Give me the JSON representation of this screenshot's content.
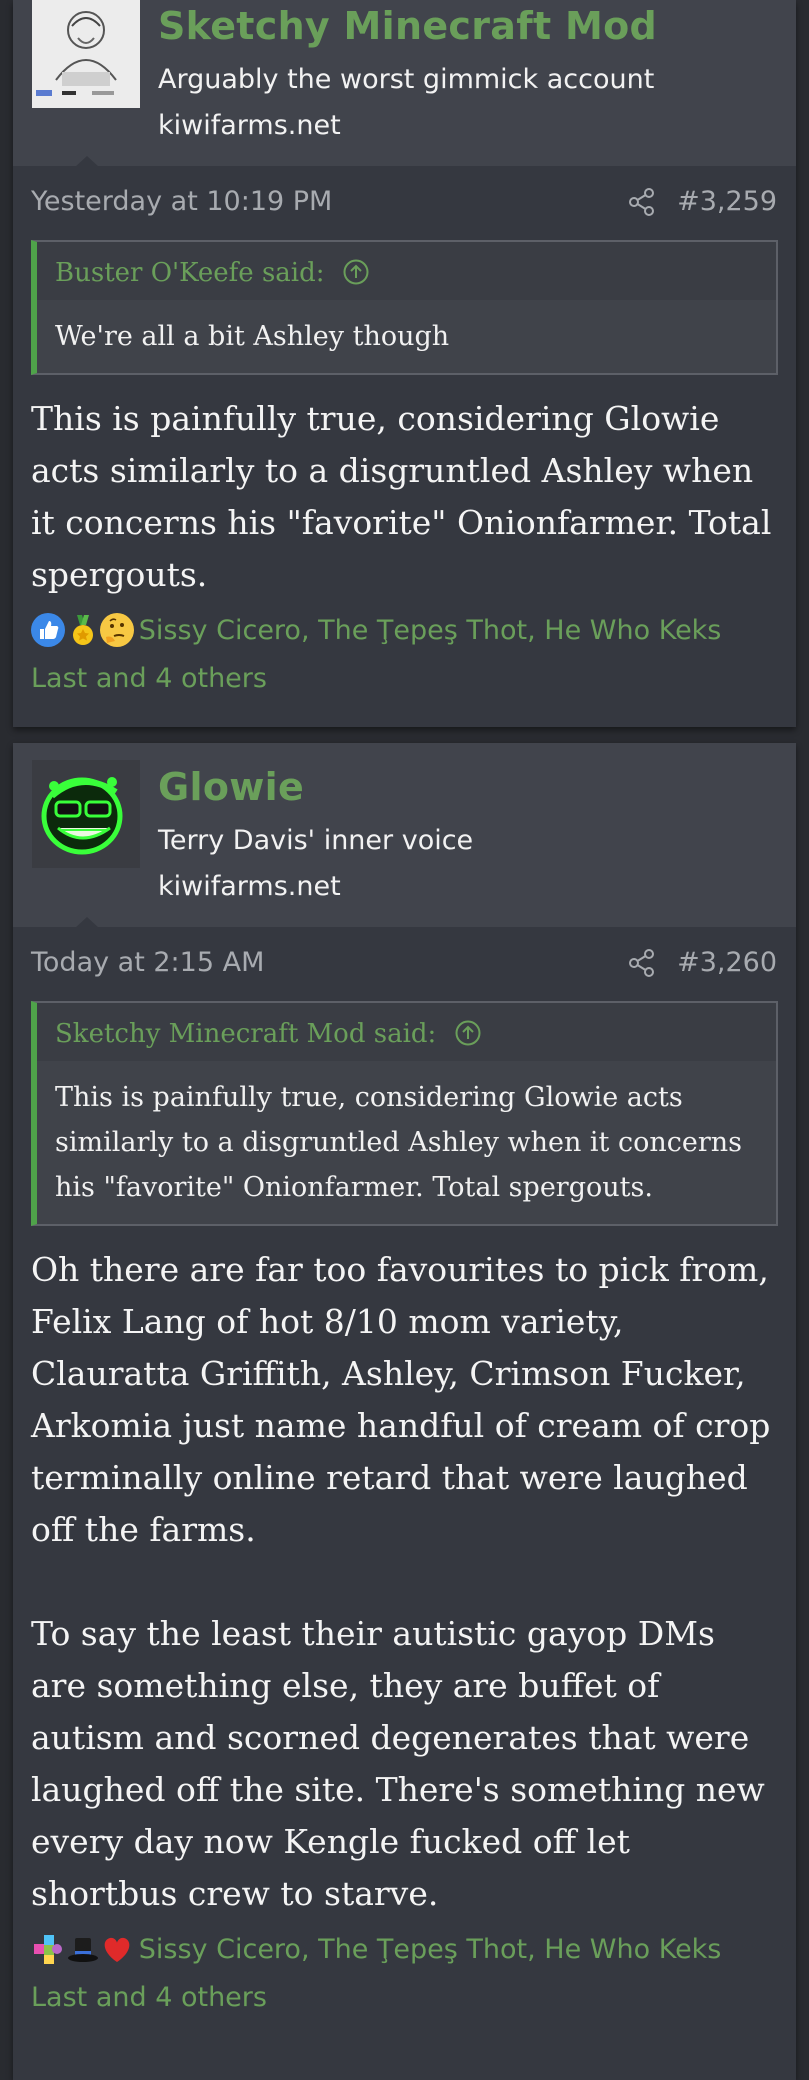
{
  "posts": [
    {
      "author": "Sketchy Minecraft Mod",
      "title": "Arguably the worst gimmick account",
      "site": "kiwifarms.net",
      "date": "Yesterday at 10:19 PM",
      "number": "#3,259",
      "quote": {
        "header": "Buster O'Keefe said:",
        "body": "We're all a bit Ashley though"
      },
      "message": [
        "This is painfully true, considering Glowie acts similarly to a disgruntled Ashley when it concerns his \"favorite\" Onionfarmer. Total spergouts."
      ],
      "reactions": {
        "icons": [
          "thumbs-up",
          "medal",
          "thinking-face"
        ],
        "text": "Sissy Cicero, The Ţepeş Thot, He Who Keks Last and 4 others"
      }
    },
    {
      "author": "Glowie",
      "title": "Terry Davis' inner voice",
      "site": "kiwifarms.net",
      "date": "Today at 2:15 AM",
      "number": "#3,260",
      "quote": {
        "header": "Sketchy Minecraft Mod said:",
        "body": "This is painfully true, considering Glowie acts similarly to a disgruntled Ashley when it concerns his \"favorite\" Onionfarmer. Total spergouts."
      },
      "message": [
        "Oh there are far too favourites to pick from, Felix Lang of hot 8/10 mom variety, Clauratta Griffith, Ashley, Crimson Fucker, Arkomia just name handful of cream of crop terminally online retard that were laughed off the farms.",
        "To say the least their autistic gayop DMs are something else, they are buffet of autism and scorned degenerates that were laughed off the site. There's something new every day now Kengle fucked off let shortbus crew to starve."
      ],
      "reactions": {
        "icons": [
          "puzzle-piece",
          "top-hat",
          "heart"
        ],
        "text": "Sissy Cicero, The Ţepeş Thot, He Who Keks Last and 4 others"
      }
    }
  ]
}
